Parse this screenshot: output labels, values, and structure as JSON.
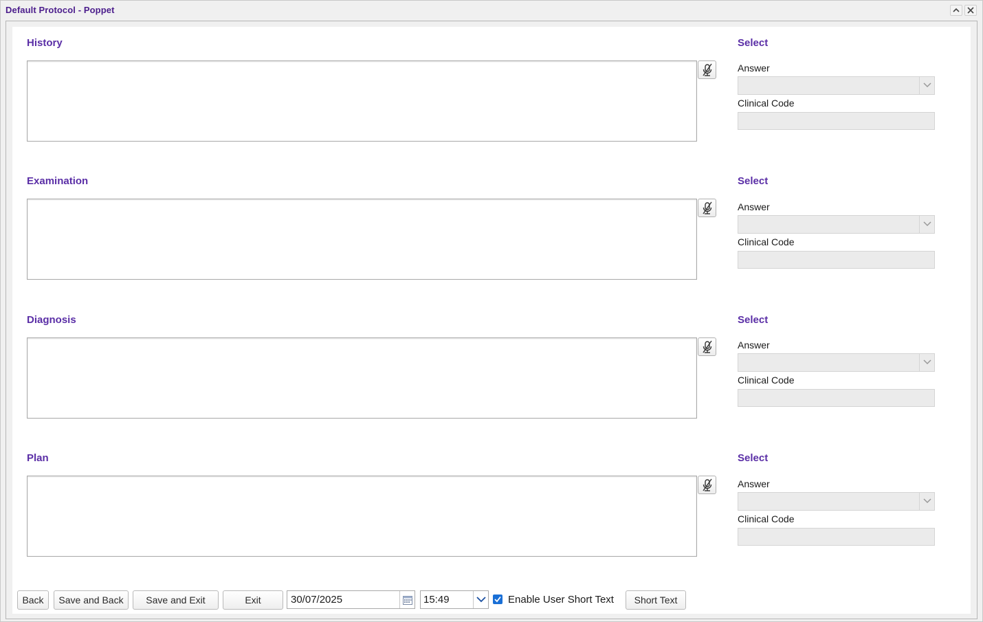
{
  "window": {
    "title": "Default Protocol - Poppet"
  },
  "sections": [
    {
      "title": "History",
      "select_heading": "Select",
      "answer_label": "Answer",
      "answer_value": "",
      "code_label": "Clinical Code",
      "code_value": "",
      "notes": ""
    },
    {
      "title": "Examination",
      "select_heading": "Select",
      "answer_label": "Answer",
      "answer_value": "",
      "code_label": "Clinical Code",
      "code_value": "",
      "notes": ""
    },
    {
      "title": "Diagnosis",
      "select_heading": "Select",
      "answer_label": "Answer",
      "answer_value": "",
      "code_label": "Clinical Code",
      "code_value": "",
      "notes": ""
    },
    {
      "title": "Plan",
      "select_heading": "Select",
      "answer_label": "Answer",
      "answer_value": "",
      "code_label": "Clinical Code",
      "code_value": "",
      "notes": ""
    }
  ],
  "footer": {
    "back_label": "Back",
    "save_back_label": "Save and Back",
    "save_exit_label": "Save and Exit",
    "exit_label": "Exit",
    "date_value": "30/07/2025",
    "time_value": "15:49",
    "enable_short_text_label": "Enable User Short Text",
    "enable_short_text_checked": true,
    "short_text_label": "Short Text"
  },
  "icons": {
    "collapse": "chevron-up-icon",
    "close": "close-icon",
    "mic": "microphone-muted-icon",
    "dropdown": "chevron-down-icon",
    "calendar": "calendar-icon",
    "checkbox": "checkmark-icon"
  },
  "colors": {
    "title": "#4b1d8c",
    "section_heading": "#5a2ea6",
    "checkbox": "#1a6fd6",
    "disabled_field": "#ebebeb"
  }
}
